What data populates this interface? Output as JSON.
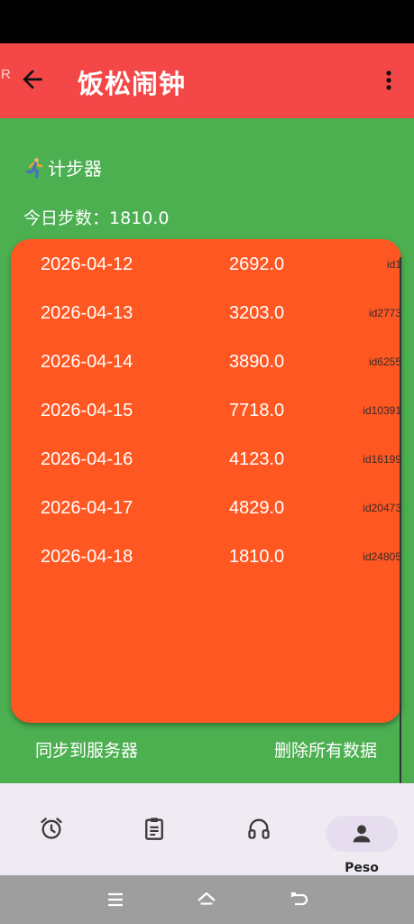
{
  "app_bar": {
    "corner_mark": "R",
    "title": "饭松闹钟",
    "back_icon": "arrow-left-icon",
    "menu_icon": "more-vert-icon"
  },
  "section": {
    "icon": "runner-icon",
    "title": "计步器",
    "today_label": "今日步数：",
    "today_value": "1810.0"
  },
  "records": [
    {
      "date": "2026-04-12",
      "steps": "2692.0",
      "id": "id1"
    },
    {
      "date": "2026-04-13",
      "steps": "3203.0",
      "id": "id2773"
    },
    {
      "date": "2026-04-14",
      "steps": "3890.0",
      "id": "id6255"
    },
    {
      "date": "2026-04-15",
      "steps": "7718.0",
      "id": "id10391"
    },
    {
      "date": "2026-04-16",
      "steps": "4123.0",
      "id": "id16199"
    },
    {
      "date": "2026-04-17",
      "steps": "4829.0",
      "id": "id20473"
    },
    {
      "date": "2026-04-18",
      "steps": "1810.0",
      "id": "id24805"
    }
  ],
  "actions": {
    "sync": "同步到服务器",
    "delete_all": "删除所有数据"
  },
  "bottom_nav": {
    "items": [
      {
        "icon": "alarm-clock-icon",
        "label": ""
      },
      {
        "icon": "clipboard-icon",
        "label": ""
      },
      {
        "icon": "headphones-icon",
        "label": ""
      },
      {
        "icon": "person-icon",
        "label": "Peso",
        "active": true
      }
    ]
  },
  "system_nav": [
    "menu-icon",
    "home-icon",
    "back-icon"
  ],
  "colors": {
    "app_bar": "#f44848",
    "background": "#4caf50",
    "card": "#ff5722",
    "nav_bg": "#f0ebf3",
    "nav_pill": "#e6deef"
  }
}
